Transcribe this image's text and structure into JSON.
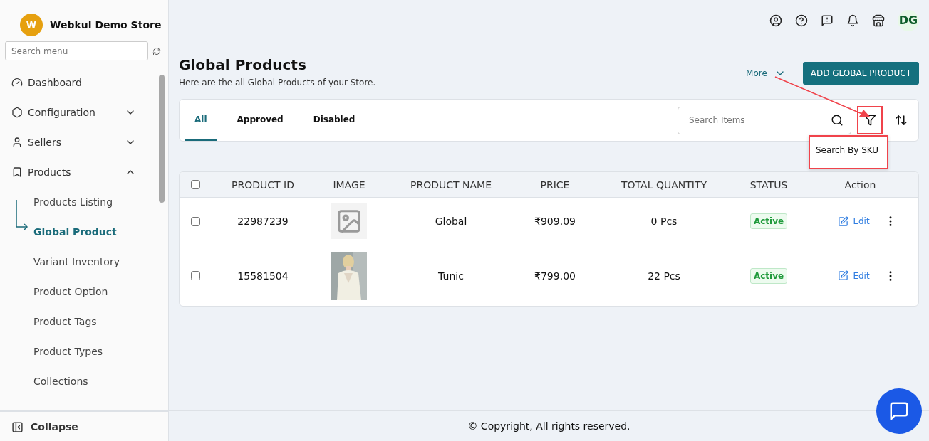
{
  "store": {
    "initial": "W",
    "name": "Webkul Demo Store"
  },
  "sidebar": {
    "search": {
      "placeholder": "Search menu"
    },
    "items": [
      {
        "kind": "dashboard",
        "label": "Dashboard"
      },
      {
        "kind": "config",
        "label": "Configuration",
        "expanded": false,
        "has_children": true
      },
      {
        "kind": "sellers",
        "label": "Sellers",
        "expanded": false,
        "has_children": true
      },
      {
        "kind": "products",
        "label": "Products",
        "expanded": true,
        "has_children": true,
        "children": [
          {
            "label": "Products Listing",
            "selected": false
          },
          {
            "label": "Global Product",
            "selected": true
          },
          {
            "label": "Variant Inventory",
            "selected": false
          },
          {
            "label": "Product Option",
            "selected": false
          },
          {
            "label": "Product Tags",
            "selected": false
          },
          {
            "label": "Product Types",
            "selected": false
          },
          {
            "label": "Collections",
            "selected": false
          }
        ]
      }
    ],
    "collapse": "Collapse"
  },
  "topbar": {
    "avatar": "DG"
  },
  "page": {
    "title": "Global Products",
    "subtitle": "Here are the all Global Products of your Store.",
    "more": "More",
    "add_button": "ADD GLOBAL PRODUCT"
  },
  "tabs": [
    {
      "label": "All",
      "selected": true
    },
    {
      "label": "Approved",
      "selected": false
    },
    {
      "label": "Disabled",
      "selected": false
    }
  ],
  "search": {
    "placeholder": "Search Items"
  },
  "filter_tooltip": "Search By SKU",
  "table": {
    "header_checked": false,
    "columns": [
      "PRODUCT ID",
      "IMAGE",
      "PRODUCT NAME",
      "PRICE",
      "TOTAL QUANTITY",
      "STATUS",
      "Action"
    ],
    "rows": [
      {
        "checked": false,
        "id": "22987239",
        "kind": "placeholder",
        "name": "Global",
        "price": "₹909.09",
        "quantity": "0 Pcs",
        "status": "Active",
        "action": "Edit"
      },
      {
        "checked": false,
        "id": "15581504",
        "kind": "picture",
        "name": "Tunic",
        "price": "₹799.00",
        "quantity": "22 Pcs",
        "status": "Active",
        "action": "Edit"
      }
    ]
  },
  "footer": "© Copyright, All rights reserved."
}
